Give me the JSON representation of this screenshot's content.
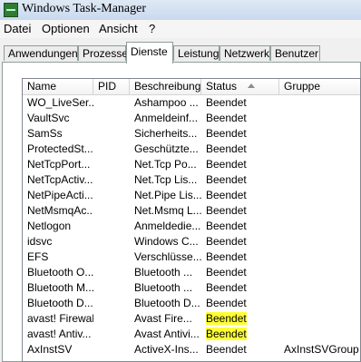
{
  "window": {
    "title": "Windows Task-Manager"
  },
  "menu": [
    "Datei",
    "Optionen",
    "Ansicht",
    "?"
  ],
  "tabs": [
    "Anwendungen",
    "Prozesse",
    "Dienste",
    "Leistung",
    "Netzwerk",
    "Benutzer"
  ],
  "active_tab": "Dienste",
  "columns": [
    "Name",
    "PID",
    "Beschreibung",
    "Status",
    "Gruppe"
  ],
  "sort_column": "Status",
  "colors": {
    "highlight": "#ffff33"
  },
  "rows": [
    {
      "name": "WO_LiveSer...",
      "pid": "",
      "desc": "Ashampoo ...",
      "status": "Beendet",
      "group": "",
      "highlight": false
    },
    {
      "name": "VaultSvc",
      "pid": "",
      "desc": "Anmeldeinf...",
      "status": "Beendet",
      "group": "",
      "highlight": false
    },
    {
      "name": "SamSs",
      "pid": "",
      "desc": "Sicherheits...",
      "status": "Beendet",
      "group": "",
      "highlight": false
    },
    {
      "name": "ProtectedSt...",
      "pid": "",
      "desc": "Geschützte...",
      "status": "Beendet",
      "group": "",
      "highlight": false
    },
    {
      "name": "NetTcpPort...",
      "pid": "",
      "desc": "Net.Tcp Po...",
      "status": "Beendet",
      "group": "",
      "highlight": false
    },
    {
      "name": "NetTcpActiv...",
      "pid": "",
      "desc": "Net.Tcp Lis...",
      "status": "Beendet",
      "group": "",
      "highlight": false
    },
    {
      "name": "NetPipeActi...",
      "pid": "",
      "desc": "Net.Pipe Lis...",
      "status": "Beendet",
      "group": "",
      "highlight": false
    },
    {
      "name": "NetMsmqAc...",
      "pid": "",
      "desc": "Net.Msmq L...",
      "status": "Beendet",
      "group": "",
      "highlight": false
    },
    {
      "name": "Netlogon",
      "pid": "",
      "desc": "Anmeldedie...",
      "status": "Beendet",
      "group": "",
      "highlight": false
    },
    {
      "name": "idsvc",
      "pid": "",
      "desc": "Windows C...",
      "status": "Beendet",
      "group": "",
      "highlight": false
    },
    {
      "name": "EFS",
      "pid": "",
      "desc": "Verschlüsse...",
      "status": "Beendet",
      "group": "",
      "highlight": false
    },
    {
      "name": "Bluetooth O...",
      "pid": "",
      "desc": "Bluetooth ...",
      "status": "Beendet",
      "group": "",
      "highlight": false
    },
    {
      "name": "Bluetooth M...",
      "pid": "",
      "desc": "Bluetooth ...",
      "status": "Beendet",
      "group": "",
      "highlight": false
    },
    {
      "name": "Bluetooth D...",
      "pid": "",
      "desc": "Bluetooth D...",
      "status": "Beendet",
      "group": "",
      "highlight": false
    },
    {
      "name": "avast! Firewall",
      "pid": "",
      "desc": "Avast Fire...",
      "status": "Beendet",
      "group": "",
      "highlight": true
    },
    {
      "name": "avast! Antiv...",
      "pid": "",
      "desc": "Avast Antivi...",
      "status": "Beendet",
      "group": "",
      "highlight": true
    },
    {
      "name": "AxInstSV",
      "pid": "",
      "desc": "ActiveX-Ins...",
      "status": "Beendet",
      "group": "AxInstSVGroup",
      "highlight": false
    }
  ]
}
